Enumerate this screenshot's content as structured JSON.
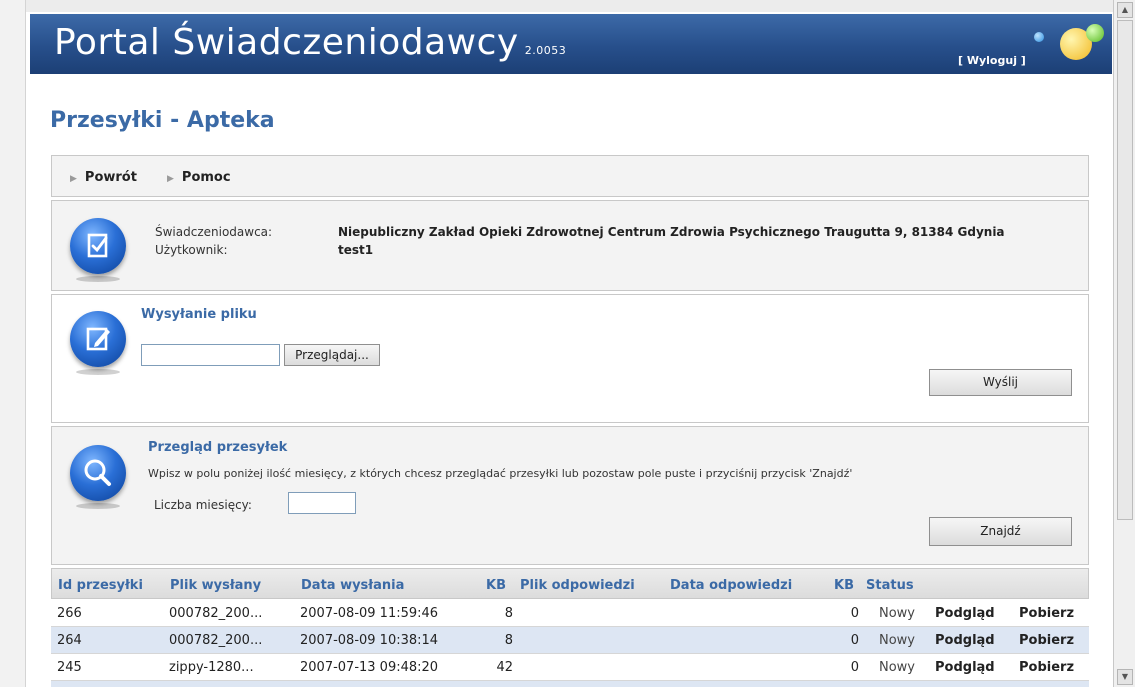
{
  "header": {
    "title": "Portal Świadczeniodawcy",
    "version": "2.0053",
    "logout_label": "[ Wyloguj ]"
  },
  "page_title": "Przesyłki - Apteka",
  "nav": {
    "items": [
      {
        "label": "Powrót"
      },
      {
        "label": "Pomoc"
      }
    ]
  },
  "info": {
    "provider_label": "Świadczeniodawca:",
    "provider_value": "Niepubliczny Zakład Opieki Zdrowotnej Centrum Zdrowia Psychicznego Traugutta 9, 81384 Gdynia",
    "user_label": "Użytkownik:",
    "user_value": "test1"
  },
  "upload": {
    "title": "Wysyłanie pliku",
    "file_value": "",
    "browse_label": "Przeglądaj...",
    "send_label": "Wyślij"
  },
  "search": {
    "title": "Przegląd przesyłek",
    "hint": "Wpisz w polu poniżej ilość miesięcy, z których chcesz przeglądać przesyłki lub pozostaw pole puste i przyciśnij przycisk 'Znajdź'",
    "months_label": "Liczba miesięcy:",
    "months_value": "",
    "find_label": "Znajdź"
  },
  "table": {
    "headers": [
      "Id przesyłki",
      "Plik wysłany",
      "Data wysłania",
      "KB",
      "Plik odpowiedzi",
      "Data odpowiedzi",
      "KB",
      "Status"
    ],
    "rows": [
      {
        "id": "266",
        "file": "000782_200...",
        "date": "2007-08-09 11:59:46",
        "kb": "8",
        "reply_file": "",
        "reply_date": "",
        "reply_kb": "0",
        "status": "Nowy",
        "preview": "Podgląd",
        "download": "Pobierz"
      },
      {
        "id": "264",
        "file": "000782_200...",
        "date": "2007-08-09 10:38:14",
        "kb": "8",
        "reply_file": "",
        "reply_date": "",
        "reply_kb": "0",
        "status": "Nowy",
        "preview": "Podgląd",
        "download": "Pobierz"
      },
      {
        "id": "245",
        "file": "zippy-1280...",
        "date": "2007-07-13 09:48:20",
        "kb": "42",
        "reply_file": "",
        "reply_date": "",
        "reply_kb": "0",
        "status": "Nowy",
        "preview": "Podgląd",
        "download": "Pobierz"
      }
    ]
  },
  "icons": {
    "info": "document-check-icon",
    "upload": "document-edit-icon",
    "search": "magnifier-icon"
  },
  "colors": {
    "header_bg": "#274f8b",
    "accent": "#3b6aa6",
    "row_alt": "#dde6f3"
  }
}
